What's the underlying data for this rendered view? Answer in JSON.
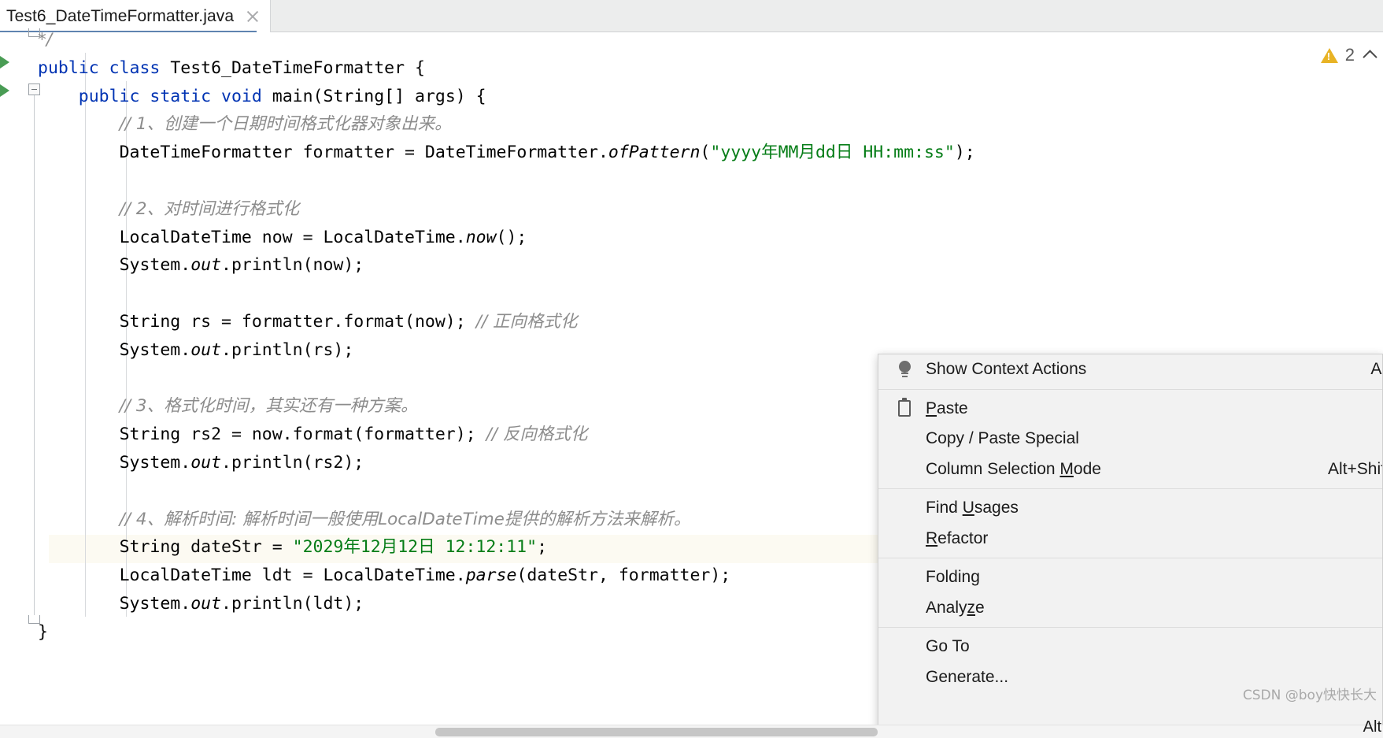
{
  "window": {
    "tab": {
      "title": "Test6_DateTimeFormatter.java",
      "close_icon": "close-icon"
    }
  },
  "editor": {
    "inspection_widget": {
      "warning_icon": "warning-triangle-icon",
      "warning_count": "2",
      "collapse_icon": "chevron-up-icon"
    },
    "lines": [
      {
        "indent": 0,
        "tokens": [
          {
            "t": "*/",
            "c": "cmt"
          }
        ]
      },
      {
        "indent": 0,
        "tokens": [
          {
            "t": "public",
            "c": "kw"
          },
          {
            "t": " ",
            "c": "punc"
          },
          {
            "t": "class",
            "c": "kw"
          },
          {
            "t": " ",
            "c": "punc"
          },
          {
            "t": "Test6_DateTimeFormatter",
            "c": "cls"
          },
          {
            "t": " {",
            "c": "punc"
          }
        ]
      },
      {
        "indent": 1,
        "tokens": [
          {
            "t": "public",
            "c": "kw"
          },
          {
            "t": " ",
            "c": "punc"
          },
          {
            "t": "static",
            "c": "kw"
          },
          {
            "t": " ",
            "c": "punc"
          },
          {
            "t": "void",
            "c": "kw"
          },
          {
            "t": " ",
            "c": "punc"
          },
          {
            "t": "main",
            "c": "ident"
          },
          {
            "t": "(",
            "c": "punc"
          },
          {
            "t": "String",
            "c": "cls"
          },
          {
            "t": "[] args) {",
            "c": "punc"
          }
        ]
      },
      {
        "indent": 2,
        "tokens": [
          {
            "t": "// 1、创建一个日期时间格式化器对象出来。",
            "c": "cmt"
          }
        ]
      },
      {
        "indent": 2,
        "tokens": [
          {
            "t": "DateTimeFormatter",
            "c": "cls"
          },
          {
            "t": " formatter = ",
            "c": "punc"
          },
          {
            "t": "DateTimeFormatter",
            "c": "cls"
          },
          {
            "t": ".",
            "c": "punc"
          },
          {
            "t": "ofPattern",
            "c": "meth"
          },
          {
            "t": "(",
            "c": "punc"
          },
          {
            "t": "\"yyyy年MM月dd日 HH:mm:ss\"",
            "c": "str"
          },
          {
            "t": ");",
            "c": "punc"
          }
        ]
      },
      {
        "indent": 2,
        "tokens": []
      },
      {
        "indent": 2,
        "tokens": [
          {
            "t": "// 2、对时间进行格式化",
            "c": "cmt"
          }
        ]
      },
      {
        "indent": 2,
        "tokens": [
          {
            "t": "LocalDateTime",
            "c": "cls"
          },
          {
            "t": " now = ",
            "c": "punc"
          },
          {
            "t": "LocalDateTime",
            "c": "cls"
          },
          {
            "t": ".",
            "c": "punc"
          },
          {
            "t": "now",
            "c": "meth"
          },
          {
            "t": "();",
            "c": "punc"
          }
        ]
      },
      {
        "indent": 2,
        "tokens": [
          {
            "t": "System",
            "c": "cls"
          },
          {
            "t": ".",
            "c": "punc"
          },
          {
            "t": "out",
            "c": "meth"
          },
          {
            "t": ".println(now);",
            "c": "punc"
          }
        ]
      },
      {
        "indent": 2,
        "tokens": []
      },
      {
        "indent": 2,
        "tokens": [
          {
            "t": "String",
            "c": "cls"
          },
          {
            "t": " rs = formatter.format(now); ",
            "c": "punc"
          },
          {
            "t": "// 正向格式化",
            "c": "cmt"
          }
        ]
      },
      {
        "indent": 2,
        "tokens": [
          {
            "t": "System",
            "c": "cls"
          },
          {
            "t": ".",
            "c": "punc"
          },
          {
            "t": "out",
            "c": "meth"
          },
          {
            "t": ".println(rs);",
            "c": "punc"
          }
        ]
      },
      {
        "indent": 2,
        "tokens": []
      },
      {
        "indent": 2,
        "tokens": [
          {
            "t": "// 3、格式化时间，其实还有一种方案。",
            "c": "cmt"
          }
        ]
      },
      {
        "indent": 2,
        "tokens": [
          {
            "t": "String",
            "c": "cls"
          },
          {
            "t": " rs2 = now.format(formatter); ",
            "c": "punc"
          },
          {
            "t": "// 反向格式化",
            "c": "cmt"
          }
        ]
      },
      {
        "indent": 2,
        "tokens": [
          {
            "t": "System",
            "c": "cls"
          },
          {
            "t": ".",
            "c": "punc"
          },
          {
            "t": "out",
            "c": "meth"
          },
          {
            "t": ".println(rs2);",
            "c": "punc"
          }
        ]
      },
      {
        "indent": 2,
        "tokens": []
      },
      {
        "indent": 2,
        "tokens": [
          {
            "t": "// 4、解析时间: 解析时间一般使用LocalDateTime提供的解析方法来解析。",
            "c": "cmt"
          }
        ]
      },
      {
        "indent": 2,
        "tokens": [
          {
            "t": "String",
            "c": "cls"
          },
          {
            "t": " dateStr = ",
            "c": "punc"
          },
          {
            "t": "\"2029年12月12日 12:12:11\"",
            "c": "str"
          },
          {
            "t": ";",
            "c": "punc"
          }
        ]
      },
      {
        "indent": 2,
        "tokens": [
          {
            "t": "LocalDateTime",
            "c": "cls"
          },
          {
            "t": " ldt = ",
            "c": "punc"
          },
          {
            "t": "LocalDateTime",
            "c": "cls"
          },
          {
            "t": ".",
            "c": "punc"
          },
          {
            "t": "parse",
            "c": "meth"
          },
          {
            "t": "(dateStr, formatter);",
            "c": "punc"
          }
        ]
      },
      {
        "indent": 2,
        "tokens": [
          {
            "t": "System",
            "c": "cls"
          },
          {
            "t": ".",
            "c": "punc"
          },
          {
            "t": "out",
            "c": "meth"
          },
          {
            "t": ".println(ldt);",
            "c": "punc"
          }
        ]
      },
      {
        "indent": 0,
        "tokens": [
          {
            "t": "}",
            "c": "punc"
          }
        ]
      }
    ]
  },
  "context_menu": {
    "items": [
      {
        "label": "Show Context Actions",
        "icon": "lightbulb-icon",
        "accel": "Al",
        "mnemonic": "",
        "separator_after": true
      },
      {
        "label": "Paste",
        "icon": "clipboard-icon",
        "accel": "",
        "mnemonic": "P",
        "separator_after": false
      },
      {
        "label": "Copy / Paste Special",
        "icon": "",
        "accel": "",
        "mnemonic": "",
        "separator_after": false
      },
      {
        "label": "Column Selection Mode",
        "icon": "",
        "accel": "Alt+Shif",
        "mnemonic": "M",
        "separator_after": true
      },
      {
        "label": "Find Usages",
        "icon": "",
        "accel": "",
        "mnemonic": "U",
        "separator_after": false
      },
      {
        "label": "Refactor",
        "icon": "",
        "accel": "",
        "mnemonic": "R",
        "separator_after": true
      },
      {
        "label": "Folding",
        "icon": "",
        "accel": "",
        "mnemonic": "",
        "separator_after": false
      },
      {
        "label": "Analyze",
        "icon": "",
        "accel": "",
        "mnemonic": "z",
        "separator_after": true
      },
      {
        "label": "Go To",
        "icon": "",
        "accel": "",
        "mnemonic": "",
        "separator_after": false
      },
      {
        "label": "Generate...",
        "icon": "",
        "accel": "",
        "mnemonic": "",
        "separator_after": false
      }
    ]
  },
  "overlay": {
    "watermark": "CSDN @boy快快长大",
    "corner_accel": "Alt"
  },
  "colors": {
    "keyword": "#0033b3",
    "string": "#067d17",
    "comment": "#8c8c8c",
    "warning": "#e8b325",
    "tab_underline": "#5f83b0",
    "caret_line": "#fcfaf2",
    "run_marker": "#499c54"
  }
}
